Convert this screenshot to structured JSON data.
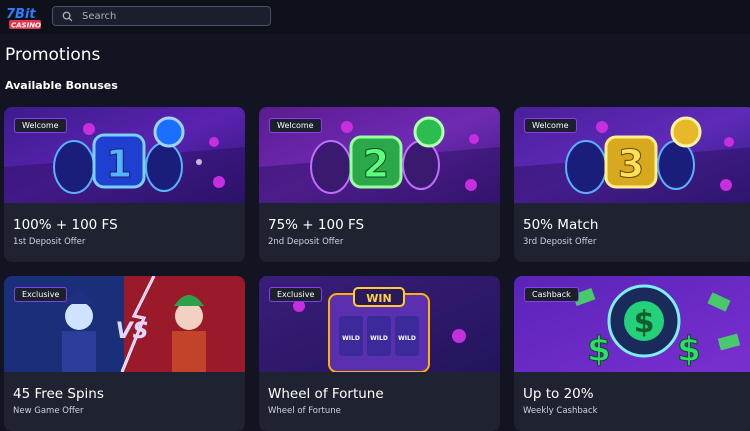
{
  "header": {
    "logo_text_top": "7Bit",
    "logo_text_bottom": "CASINO",
    "search_placeholder": "Search"
  },
  "page_title": "Promotions",
  "section_title": "Available Bonuses",
  "cards": [
    {
      "badge": "Welcome",
      "title": "100% + 100 FS",
      "subtitle": "1st Deposit Offer",
      "art": "reel-1"
    },
    {
      "badge": "Welcome",
      "title": "75% + 100 FS",
      "subtitle": "2nd Deposit Offer",
      "art": "reel-2"
    },
    {
      "badge": "Welcome",
      "title": "50% Match",
      "subtitle": "3rd Deposit Offer",
      "art": "reel-3"
    },
    {
      "badge": "Exclusive",
      "title": "45 Free Spins",
      "subtitle": "New Game Offer",
      "art": "jokers"
    },
    {
      "badge": "Exclusive",
      "title": "Wheel of Fortune",
      "subtitle": "Wheel of Fortune",
      "art": "slot-machine"
    },
    {
      "badge": "Cashback",
      "title": "Up to 20%",
      "subtitle": "Weekly Cashback",
      "art": "dollar"
    }
  ],
  "art_text": {
    "reel_digits": [
      "1",
      "2",
      "3"
    ],
    "vs": "VS",
    "win": "WIN",
    "wild": "WILD"
  },
  "colors": {
    "background": "#121521",
    "card": "#1e2231",
    "badge_border": "#8a3cf0",
    "accent_blue": "#2a8cff",
    "accent_green": "#39e06a",
    "accent_yellow": "#ffd33b"
  }
}
